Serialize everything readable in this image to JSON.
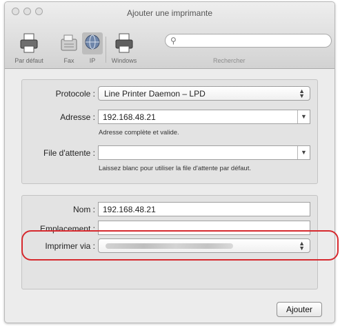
{
  "window": {
    "title": "Ajouter une imprimante"
  },
  "toolbar": {
    "items": [
      {
        "label": "Par défaut",
        "icon": "printer-icon"
      },
      {
        "label": "Fax",
        "icon": "fax-icon"
      },
      {
        "label": "IP",
        "icon": "globe-icon"
      },
      {
        "label": "Windows",
        "icon": "windows-printer-icon"
      }
    ],
    "search": {
      "label": "Rechercher",
      "placeholder": "",
      "icon": "search-icon"
    }
  },
  "connection": {
    "protocol_label": "Protocole :",
    "protocol_value": "Line Printer Daemon – LPD",
    "address_label": "Adresse :",
    "address_value": "192.168.48.21",
    "address_hint": "Adresse complète et valide.",
    "queue_label": "File d'attente :",
    "queue_value": "",
    "queue_hint": "Laissez blanc pour utiliser la file d'attente par défaut."
  },
  "details": {
    "name_label": "Nom :",
    "name_value": "192.168.48.21",
    "location_label": "Emplacement :",
    "location_value": "",
    "print_via_label": "Imprimer via :",
    "print_via_value": ""
  },
  "footer": {
    "add_button": "Ajouter"
  },
  "colors": {
    "highlight": "#d6282d",
    "window_bg": "#ececec"
  }
}
